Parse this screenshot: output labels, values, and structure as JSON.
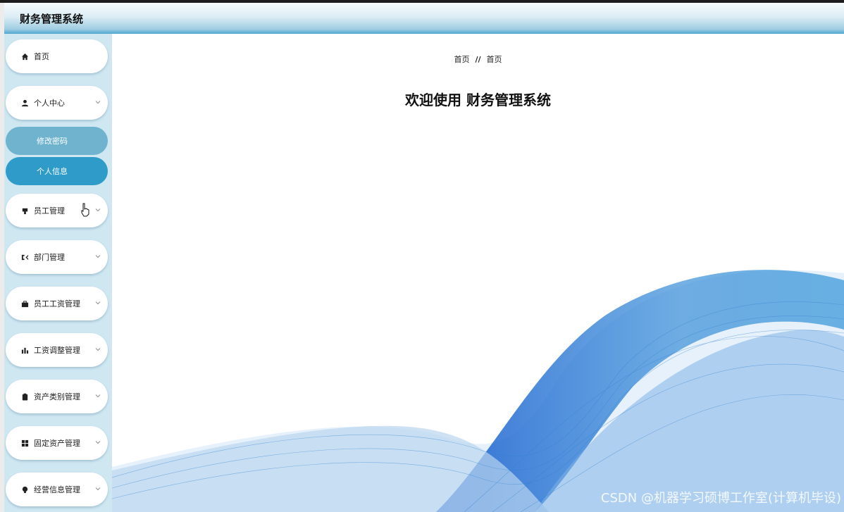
{
  "app": {
    "title": "财务管理系统"
  },
  "sidebar": {
    "items": [
      {
        "label": "首页",
        "icon": "home-icon",
        "has_chevron": false
      },
      {
        "label": "个人中心",
        "icon": "user-icon",
        "has_chevron": true
      },
      {
        "label": "员工管理",
        "icon": "staff-icon",
        "has_chevron": true
      },
      {
        "label": "部门管理",
        "icon": "department-icon",
        "has_chevron": true
      },
      {
        "label": "员工工资管理",
        "icon": "briefcase-icon",
        "has_chevron": true
      },
      {
        "label": "工资调整管理",
        "icon": "bar-chart-icon",
        "has_chevron": true
      },
      {
        "label": "资产类别管理",
        "icon": "clipboard-icon",
        "has_chevron": true
      },
      {
        "label": "固定资产管理",
        "icon": "grid-icon",
        "has_chevron": true
      },
      {
        "label": "经营信息管理",
        "icon": "bulb-icon",
        "has_chevron": true
      }
    ],
    "submenu": [
      {
        "label": "修改密码"
      },
      {
        "label": "个人信息"
      }
    ]
  },
  "main": {
    "breadcrumb": {
      "items": [
        "首页",
        "首页"
      ],
      "separator": "//"
    },
    "welcome": "欢迎使用 财务管理系统"
  },
  "watermark": "CSDN @机器学习硕博工作室(计算机毕设)",
  "colors": {
    "accent": "#2f9bc9",
    "accent_light": "#6fb3cf",
    "sidebar_bg": "#cfe7f1",
    "wave": "#2f7fd0"
  }
}
